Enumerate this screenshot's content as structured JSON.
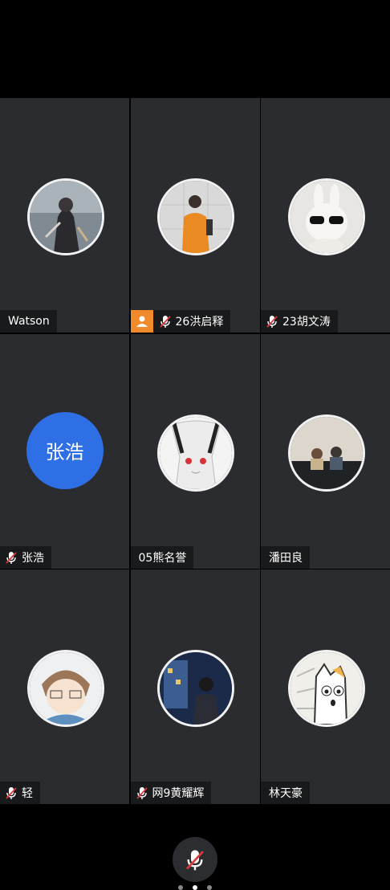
{
  "participants": [
    {
      "name": "Watson",
      "muted": false,
      "host": false,
      "avatar": "assassin-photo"
    },
    {
      "name": "26洪启释",
      "muted": true,
      "host": true,
      "avatar": "orange-jacket-photo"
    },
    {
      "name": "23胡文涛",
      "muted": true,
      "host": false,
      "avatar": "bunny-sunglasses-photo"
    },
    {
      "name": "张浩",
      "muted": true,
      "host": false,
      "avatar": "initials",
      "initials": "张浩"
    },
    {
      "name": "05熊名誉",
      "muted": false,
      "host": false,
      "avatar": "anime-girl-drawing"
    },
    {
      "name": "潘田良",
      "muted": false,
      "host": false,
      "avatar": "two-kids-photo"
    },
    {
      "name": "轻",
      "muted": true,
      "host": false,
      "avatar": "cartoon-boy-drawing"
    },
    {
      "name": "网9黄耀辉",
      "muted": true,
      "host": false,
      "avatar": "night-window-photo"
    },
    {
      "name": "林天豪",
      "muted": false,
      "host": false,
      "avatar": "cartoon-cat-drawing"
    }
  ],
  "controls": {
    "mic_state": "muted",
    "page_dots": 3,
    "active_page": 2
  },
  "colors": {
    "tile_bg": "#2b2c2f",
    "host_badge": "#f08a2a",
    "initials_bg": "#2f6fe6",
    "muted_red": "#e0393e"
  }
}
